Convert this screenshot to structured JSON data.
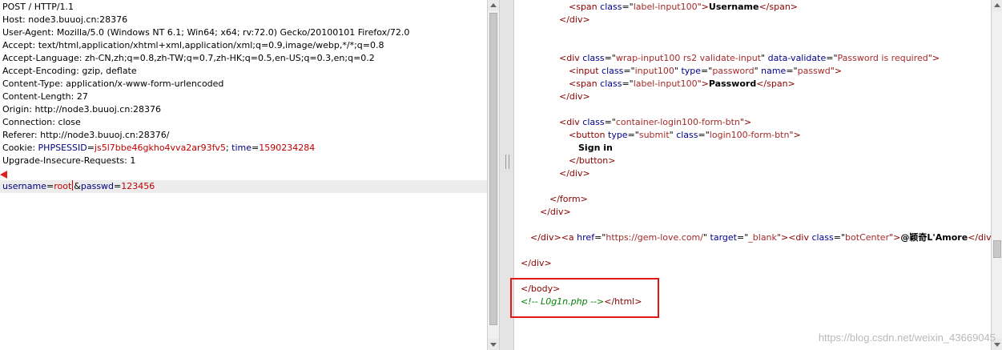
{
  "request": {
    "lines": [
      {
        "parts": [
          {
            "t": "POST / HTTP/1.1",
            "c": ""
          }
        ]
      },
      {
        "parts": [
          {
            "t": "Host: node3.buuoj.cn:28376",
            "c": ""
          }
        ]
      },
      {
        "parts": [
          {
            "t": "User-Agent: Mozilla/5.0 (Windows NT 6.1; Win64; x64; rv:72.0) Gecko/20100101 Firefox/72.0",
            "c": ""
          }
        ]
      },
      {
        "parts": [
          {
            "t": "Accept: text/html,application/xhtml+xml,application/xml;q=0.9,image/webp,*/*;q=0.8",
            "c": ""
          }
        ]
      },
      {
        "parts": [
          {
            "t": "Accept-Language: zh-CN,zh;q=0.8,zh-TW;q=0.7,zh-HK;q=0.5,en-US;q=0.3,en;q=0.2",
            "c": ""
          }
        ]
      },
      {
        "parts": [
          {
            "t": "Accept-Encoding: gzip, deflate",
            "c": ""
          }
        ]
      },
      {
        "parts": [
          {
            "t": "Content-Type: application/x-www-form-urlencoded",
            "c": ""
          }
        ]
      },
      {
        "parts": [
          {
            "t": "Content-Length: 27",
            "c": ""
          }
        ]
      },
      {
        "parts": [
          {
            "t": "Origin: http://node3.buuoj.cn:28376",
            "c": ""
          }
        ]
      },
      {
        "parts": [
          {
            "t": "Connection: close",
            "c": ""
          }
        ]
      },
      {
        "parts": [
          {
            "t": "Referer: http://node3.buuoj.cn:28376/",
            "c": ""
          }
        ]
      },
      {
        "parts": [
          {
            "t": "Cookie: ",
            "c": ""
          },
          {
            "t": "PHPSESSID",
            "c": "k"
          },
          {
            "t": "=",
            "c": ""
          },
          {
            "t": "js5l7bbe46gkho4vva2ar93fv5",
            "c": "v"
          },
          {
            "t": "; ",
            "c": ""
          },
          {
            "t": "time",
            "c": "k"
          },
          {
            "t": "=",
            "c": ""
          },
          {
            "t": "1590234284",
            "c": "v"
          }
        ]
      },
      {
        "parts": [
          {
            "t": "Upgrade-Insecure-Requests: 1",
            "c": ""
          }
        ]
      },
      {
        "parts": []
      }
    ],
    "body_parts_before_caret": [
      {
        "t": "username",
        "c": "k"
      },
      {
        "t": "=",
        "c": ""
      },
      {
        "t": "root",
        "c": "v"
      }
    ],
    "body_parts_after_caret": [
      {
        "t": "&",
        "c": ""
      },
      {
        "t": "passwd",
        "c": "k"
      },
      {
        "t": "=",
        "c": ""
      },
      {
        "t": "123456",
        "c": "v"
      }
    ]
  },
  "response": {
    "lines": [
      {
        "indent": 5,
        "parts": [
          {
            "t": "<span ",
            "c": "tag"
          },
          {
            "t": "class",
            "c": "attr"
          },
          {
            "t": "=\"",
            "c": ""
          },
          {
            "t": "label-input100",
            "c": "val"
          },
          {
            "t": "\">",
            "c": "tag"
          },
          {
            "t": "Username",
            "c": "txt"
          },
          {
            "t": "</span>",
            "c": "tag"
          }
        ]
      },
      {
        "indent": 4,
        "parts": [
          {
            "t": "</div>",
            "c": "tag"
          }
        ]
      },
      {
        "indent": 0,
        "parts": []
      },
      {
        "indent": 0,
        "parts": []
      },
      {
        "indent": 4,
        "parts": [
          {
            "t": "<div ",
            "c": "tag"
          },
          {
            "t": "class",
            "c": "attr"
          },
          {
            "t": "=\"",
            "c": ""
          },
          {
            "t": "wrap-input100 rs2 validate-input",
            "c": "val"
          },
          {
            "t": "\" ",
            "c": ""
          },
          {
            "t": "data-validate",
            "c": "attr"
          },
          {
            "t": "=\"",
            "c": ""
          },
          {
            "t": "Password is required",
            "c": "val"
          },
          {
            "t": "\">",
            "c": "tag"
          }
        ]
      },
      {
        "indent": 5,
        "parts": [
          {
            "t": "<input ",
            "c": "tag"
          },
          {
            "t": "class",
            "c": "attr"
          },
          {
            "t": "=\"",
            "c": ""
          },
          {
            "t": "input100",
            "c": "val"
          },
          {
            "t": "\" ",
            "c": ""
          },
          {
            "t": "type",
            "c": "attr"
          },
          {
            "t": "=\"",
            "c": ""
          },
          {
            "t": "password",
            "c": "val"
          },
          {
            "t": "\" ",
            "c": ""
          },
          {
            "t": "name",
            "c": "attr"
          },
          {
            "t": "=\"",
            "c": ""
          },
          {
            "t": "passwd",
            "c": "val"
          },
          {
            "t": "\">",
            "c": "tag"
          }
        ]
      },
      {
        "indent": 5,
        "parts": [
          {
            "t": "<span ",
            "c": "tag"
          },
          {
            "t": "class",
            "c": "attr"
          },
          {
            "t": "=\"",
            "c": ""
          },
          {
            "t": "label-input100",
            "c": "val"
          },
          {
            "t": "\">",
            "c": "tag"
          },
          {
            "t": "Password",
            "c": "txt"
          },
          {
            "t": "</span>",
            "c": "tag"
          }
        ]
      },
      {
        "indent": 4,
        "parts": [
          {
            "t": "</div>",
            "c": "tag"
          }
        ]
      },
      {
        "indent": 0,
        "parts": []
      },
      {
        "indent": 4,
        "parts": [
          {
            "t": "<div ",
            "c": "tag"
          },
          {
            "t": "class",
            "c": "attr"
          },
          {
            "t": "=\"",
            "c": ""
          },
          {
            "t": "container-login100-form-btn",
            "c": "val"
          },
          {
            "t": "\">",
            "c": "tag"
          }
        ]
      },
      {
        "indent": 5,
        "parts": [
          {
            "t": "<button ",
            "c": "tag"
          },
          {
            "t": "type",
            "c": "attr"
          },
          {
            "t": "=\"",
            "c": ""
          },
          {
            "t": "submit",
            "c": "val"
          },
          {
            "t": "\" ",
            "c": ""
          },
          {
            "t": "class",
            "c": "attr"
          },
          {
            "t": "=\"",
            "c": ""
          },
          {
            "t": "login100-form-btn",
            "c": "val"
          },
          {
            "t": "\">",
            "c": "tag"
          }
        ]
      },
      {
        "indent": 6,
        "parts": [
          {
            "t": "Sign in",
            "c": "txt"
          }
        ]
      },
      {
        "indent": 5,
        "parts": [
          {
            "t": "</button>",
            "c": "tag"
          }
        ]
      },
      {
        "indent": 4,
        "parts": [
          {
            "t": "</div>",
            "c": "tag"
          }
        ]
      },
      {
        "indent": 0,
        "parts": []
      },
      {
        "indent": 3,
        "parts": [
          {
            "t": "</form>",
            "c": "tag"
          }
        ]
      },
      {
        "indent": 2,
        "parts": [
          {
            "t": "</div>",
            "c": "tag"
          }
        ]
      },
      {
        "indent": 0,
        "parts": []
      },
      {
        "indent": 1,
        "parts": [
          {
            "t": "</div>",
            "c": "tag"
          },
          {
            "t": "<a ",
            "c": "tag"
          },
          {
            "t": "href",
            "c": "attr"
          },
          {
            "t": "=\"",
            "c": ""
          },
          {
            "t": "https://gem-love.com/",
            "c": "val"
          },
          {
            "t": "\" ",
            "c": ""
          },
          {
            "t": "target",
            "c": "attr"
          },
          {
            "t": "=\"",
            "c": ""
          },
          {
            "t": "_blank",
            "c": "val"
          },
          {
            "t": "\">",
            "c": "tag"
          },
          {
            "t": "<div ",
            "c": "tag"
          },
          {
            "t": "class",
            "c": "attr"
          },
          {
            "t": "=\"",
            "c": ""
          },
          {
            "t": "botCenter",
            "c": "val"
          },
          {
            "t": "\">",
            "c": "tag"
          },
          {
            "t": "@颖奇L'Amore",
            "c": "txt"
          },
          {
            "t": "</div></a>",
            "c": "tag"
          }
        ]
      },
      {
        "indent": 0,
        "parts": []
      },
      {
        "indent": 0,
        "parts": [
          {
            "t": "</div>",
            "c": "tag"
          }
        ]
      },
      {
        "indent": 0,
        "parts": []
      },
      {
        "indent": 0,
        "parts": [
          {
            "t": "</body>",
            "c": "tag"
          }
        ]
      },
      {
        "indent": 0,
        "parts": [
          {
            "t": "<!-- L0g1n.php -->",
            "c": "cmt"
          },
          {
            "t": "</html>",
            "c": "tag"
          }
        ]
      }
    ]
  },
  "watermark": "https://blog.csdn.net/weixin_43669045",
  "colors": {
    "highlight": "#e01818",
    "marker": "#e02020"
  }
}
